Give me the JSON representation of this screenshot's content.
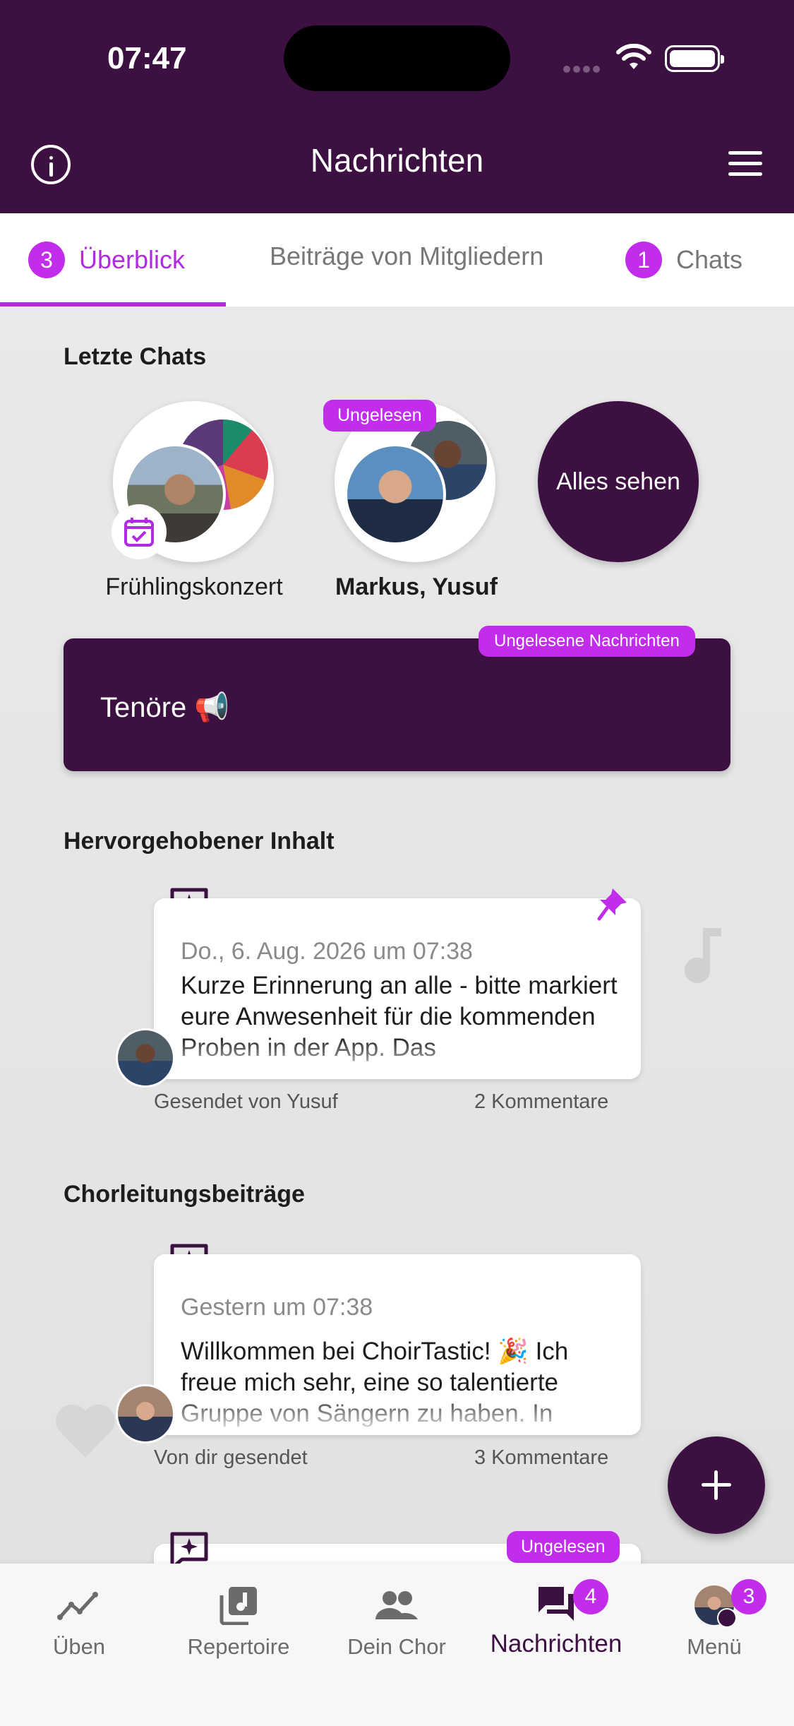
{
  "status_bar": {
    "time": "07:47"
  },
  "header": {
    "title": "Nachrichten"
  },
  "tabs": [
    {
      "label": "Überblick",
      "badge": "3"
    },
    {
      "label": "Beiträge von Mitgliedern"
    },
    {
      "label": "Chats",
      "badge": "1"
    }
  ],
  "recent_chats": {
    "title": "Letzte Chats",
    "items": [
      {
        "label": "Frühlingskonzert"
      },
      {
        "label": "Markus, Yusuf",
        "badge": "Ungelesen"
      }
    ],
    "see_all": "Alles sehen"
  },
  "banner": {
    "text": "Tenöre 📢",
    "badge": "Ungelesene Nachrichten"
  },
  "highlighted": {
    "title": "Hervorgehobener Inhalt",
    "post": {
      "date": "Do., 6. Aug. 2026 um 07:38",
      "body": "Kurze Erinnerung an alle - bitte markiert eure Anwesenheit für die kommenden Proben in der App. Das",
      "sender": "Gesendet von Yusuf",
      "comments": "2 Kommentare"
    }
  },
  "leader_posts": {
    "title": "Chorleitungsbeiträge",
    "post": {
      "date": "Gestern um 07:38",
      "body": "Willkommen bei ChoirTastic! 🎉 Ich freue mich sehr, eine so talentierte Gruppe von Sängern zu haben. In",
      "sender": "Von dir gesendet",
      "comments": "3 Kommentare"
    },
    "next_badge": "Ungelesen"
  },
  "bottom_nav": [
    {
      "label": "Üben"
    },
    {
      "label": "Repertoire"
    },
    {
      "label": "Dein Chor"
    },
    {
      "label": "Nachrichten",
      "badge": "4"
    },
    {
      "label": "Menü",
      "badge": "3"
    }
  ],
  "colors": {
    "primary": "#3d1042",
    "accent": "#c12dea"
  }
}
